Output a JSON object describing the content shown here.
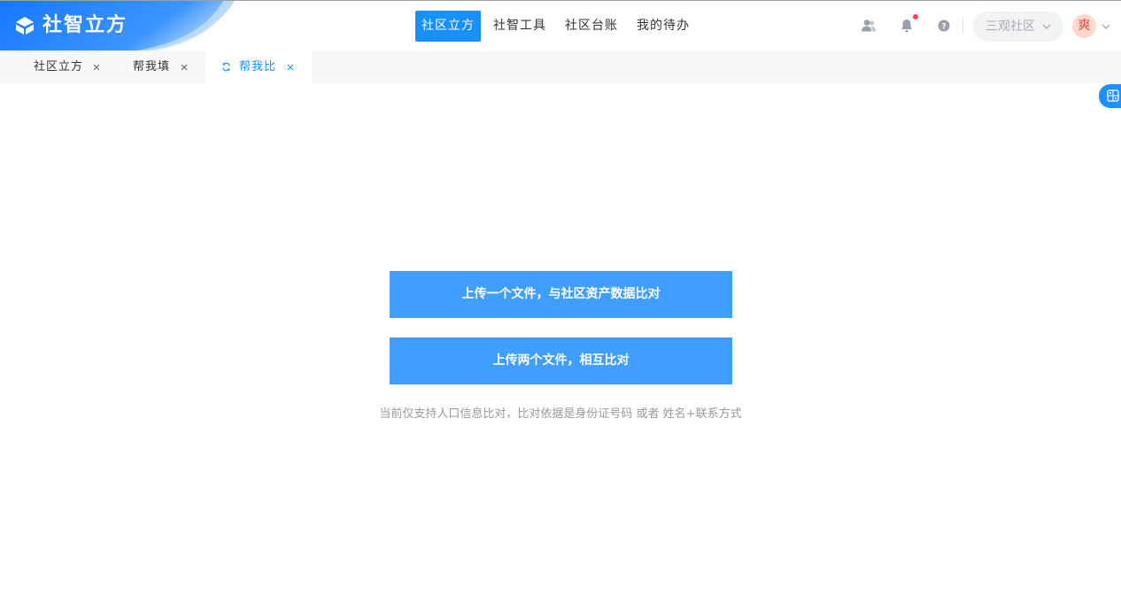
{
  "brand": {
    "name": "社智立方",
    "colors": {
      "primary": "#1890ff",
      "button": "#409eff"
    }
  },
  "nav": {
    "items": [
      {
        "label": "社区立方",
        "active": true
      },
      {
        "label": "社智工具",
        "active": false
      },
      {
        "label": "社区台账",
        "active": false
      },
      {
        "label": "我的待办",
        "active": false
      }
    ]
  },
  "header": {
    "icons": [
      "contacts-icon",
      "bell-icon",
      "help-icon"
    ],
    "community_select": "三观社区",
    "avatar_text": "爽"
  },
  "tabs": [
    {
      "label": "社区立方",
      "active": false
    },
    {
      "label": "帮我填",
      "active": false
    },
    {
      "label": "帮我比",
      "active": true
    }
  ],
  "main": {
    "btn_single": "上传一个文件，与社区资产数据比对",
    "btn_double": "上传两个文件，相互比对",
    "hint": "当前仅支持人口信息比对，比对依据是身份证号码 或者 姓名+联系方式"
  }
}
